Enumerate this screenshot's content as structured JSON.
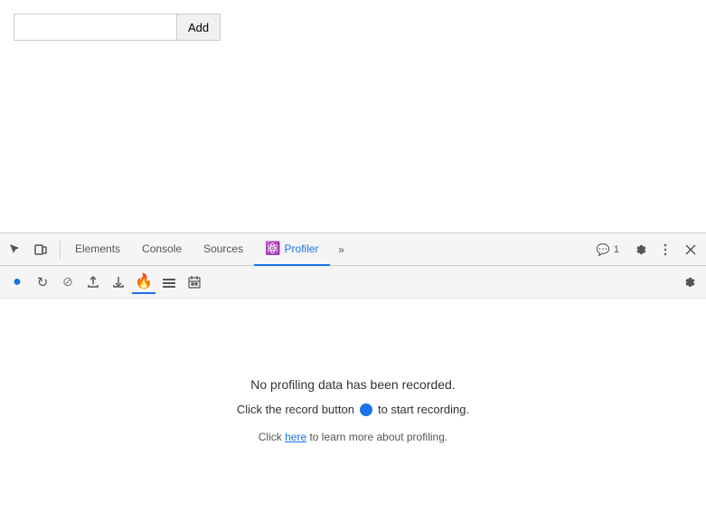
{
  "browser": {
    "add_input_value": "",
    "add_button_label": "Add"
  },
  "devtools": {
    "tabs": [
      {
        "id": "elements",
        "label": "Elements",
        "active": false
      },
      {
        "id": "console",
        "label": "Console",
        "active": false
      },
      {
        "id": "sources",
        "label": "Sources",
        "active": false
      },
      {
        "id": "profiler",
        "label": "Profiler",
        "active": true,
        "icon": "⚛️"
      }
    ],
    "more_tabs_label": "»",
    "message_badge": {
      "icon": "💬",
      "count": "1"
    },
    "toolbar": {
      "buttons": [
        {
          "id": "record",
          "icon": "●",
          "active": true,
          "title": "Start/Stop recording"
        },
        {
          "id": "reload-record",
          "icon": "↻",
          "title": "Reload and record"
        },
        {
          "id": "clear",
          "icon": "⊘",
          "title": "Clear"
        },
        {
          "id": "upload",
          "icon": "↑",
          "title": "Load profile"
        },
        {
          "id": "download",
          "icon": "↓",
          "title": "Save profile"
        },
        {
          "id": "flame",
          "icon": "🔥",
          "title": "Flamechart",
          "selected": true
        },
        {
          "id": "chart",
          "icon": "≡",
          "title": "Chart"
        },
        {
          "id": "calendar",
          "icon": "📅",
          "title": "Coverage"
        }
      ],
      "settings_icon": "⚙",
      "settings_title": "Settings"
    },
    "content": {
      "no_data_title": "No profiling data has been recorded.",
      "no_data_instruction": "Click the record button",
      "no_data_instruction_end": "to start recording.",
      "learn_more_prefix": "Click ",
      "learn_more_link": "here",
      "learn_more_suffix": " to learn more about profiling."
    }
  }
}
